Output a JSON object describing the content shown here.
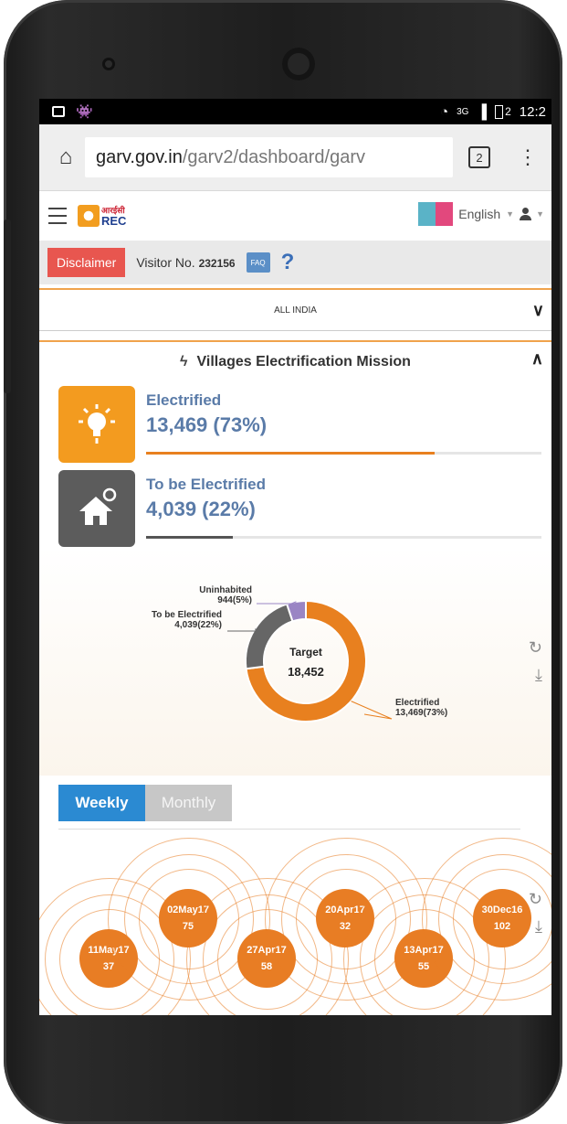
{
  "status": {
    "network": "3G",
    "battery": "2",
    "time": "12:2"
  },
  "browser": {
    "url_host": "garv.gov.in",
    "url_path": "/garv2/dashboard/garv",
    "tab_count": "2"
  },
  "header": {
    "logo_hindi": "आरईसी",
    "logo_name": "REC",
    "language": "English"
  },
  "notice": {
    "disclaimer": "Disclaimer",
    "visitor_label": "Visitor No.",
    "visitor_number": "232156",
    "faq": "FAQ",
    "help": "?"
  },
  "region": {
    "selected": "ALL INDIA"
  },
  "mission": {
    "title": "Villages Electrification Mission"
  },
  "stats": [
    {
      "label": "Electrified",
      "value": "13,469 (73%)",
      "progress": 0.73,
      "color": "#e8801f"
    },
    {
      "label": "To be Electrified",
      "value": "4,039 (22%)",
      "progress": 0.22,
      "color": "#555555"
    }
  ],
  "donut": {
    "center_label": "Target",
    "center_value": "18,452",
    "slices": [
      {
        "name": "Electrified",
        "value": 13469,
        "label": "13,469(73%)",
        "color": "#e8801f"
      },
      {
        "name": "To be Electrified",
        "value": 4039,
        "label": "4,039(22%)",
        "color": "#666666"
      },
      {
        "name": "Uninhabited",
        "value": 944,
        "label": "944(5%)",
        "color": "#9a85c4"
      }
    ]
  },
  "tabs": {
    "weekly": "Weekly",
    "monthly": "Monthly"
  },
  "weekly_bubbles": [
    {
      "date": "11May17",
      "count": "37"
    },
    {
      "date": "02May17",
      "count": "75"
    },
    {
      "date": "27Apr17",
      "count": "58"
    },
    {
      "date": "20Apr17",
      "count": "32"
    },
    {
      "date": "13Apr17",
      "count": "55"
    },
    {
      "date": "30Dec16",
      "count": "102"
    }
  ]
}
